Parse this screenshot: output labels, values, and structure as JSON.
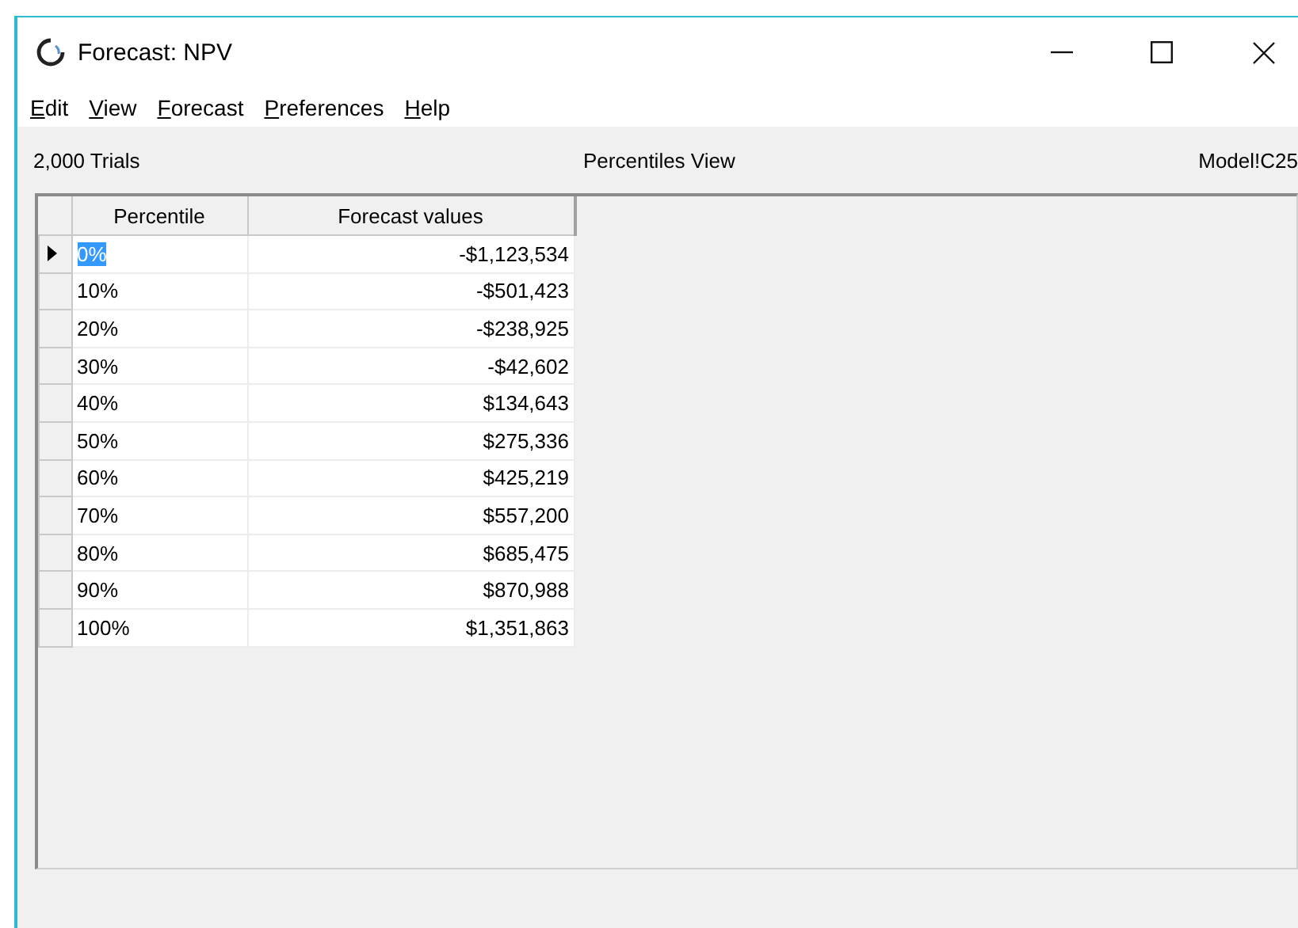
{
  "window": {
    "title": "Forecast: NPV"
  },
  "menu": [
    {
      "label": "Edit"
    },
    {
      "label": "View"
    },
    {
      "label": "Forecast"
    },
    {
      "label": "Preferences"
    },
    {
      "label": "Help"
    }
  ],
  "status": {
    "trials": "2,000 Trials",
    "view": "Percentiles View",
    "cell": "Model!C25"
  },
  "table": {
    "columns": [
      "Percentile",
      "Forecast values"
    ],
    "rows": [
      {
        "percentile": "0%",
        "value": "-$1,123,534",
        "selected": true
      },
      {
        "percentile": "10%",
        "value": "-$501,423",
        "selected": false
      },
      {
        "percentile": "20%",
        "value": "-$238,925",
        "selected": false
      },
      {
        "percentile": "30%",
        "value": "-$42,602",
        "selected": false
      },
      {
        "percentile": "40%",
        "value": "$134,643",
        "selected": false
      },
      {
        "percentile": "50%",
        "value": "$275,336",
        "selected": false
      },
      {
        "percentile": "60%",
        "value": "$425,219",
        "selected": false
      },
      {
        "percentile": "70%",
        "value": "$557,200",
        "selected": false
      },
      {
        "percentile": "80%",
        "value": "$685,475",
        "selected": false
      },
      {
        "percentile": "90%",
        "value": "$870,988",
        "selected": false
      },
      {
        "percentile": "100%",
        "value": "$1,351,863",
        "selected": false
      }
    ]
  }
}
